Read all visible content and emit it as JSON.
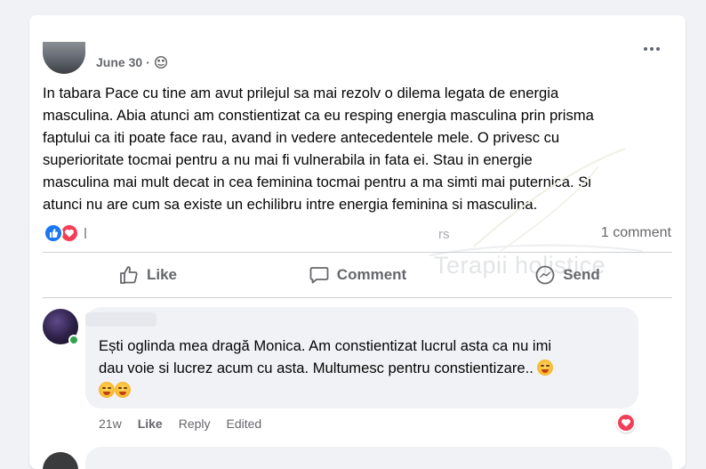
{
  "post": {
    "date": "June 30",
    "separator": "·",
    "privacy_icon": "globe-icon",
    "lines": [
      "In tabara Pace cu tine am avut prilejul sa mai rezolv o dilema legata de energia",
      "masculina. Abia atunci am constientizat ca eu resping energia masculina prin  prisma",
      "faptului ca iti poate face rau, avand in vedere antecedentele mele. O privesc  cu",
      "superioritate tocmai pentru a nu mai fi vulnerabila in fata ei. Stau in energie",
      "masculina mai mult decat in cea feminina tocmai pentru a ma simti mai puternica. Si",
      "atunci nu are cum sa existe un echilibru intre energia feminina si masculina."
    ],
    "reactions": [
      "like-icon",
      "love-icon"
    ],
    "comment_count": "1 comment",
    "watermark_rs": "rs",
    "watermark_text": "Terapii holistice"
  },
  "actions": {
    "like": "Like",
    "comment": "Comment",
    "send": "Send"
  },
  "comment": {
    "lines": [
      "Ești oglinda mea dragă Monica. Am constientizat lucrul asta ca nu imi",
      "dau voie si lucrez acum cu asta. Multumesc pentru constientizare.."
    ],
    "time": "21w",
    "like": "Like",
    "reply": "Reply",
    "edited": "Edited",
    "reaction": "love-icon"
  },
  "colors": {
    "background": "#f0f2f5",
    "like_blue": "#1877f2",
    "love_red": "#f33e58",
    "online_green": "#31a24c",
    "secondary_text": "#65676b"
  }
}
